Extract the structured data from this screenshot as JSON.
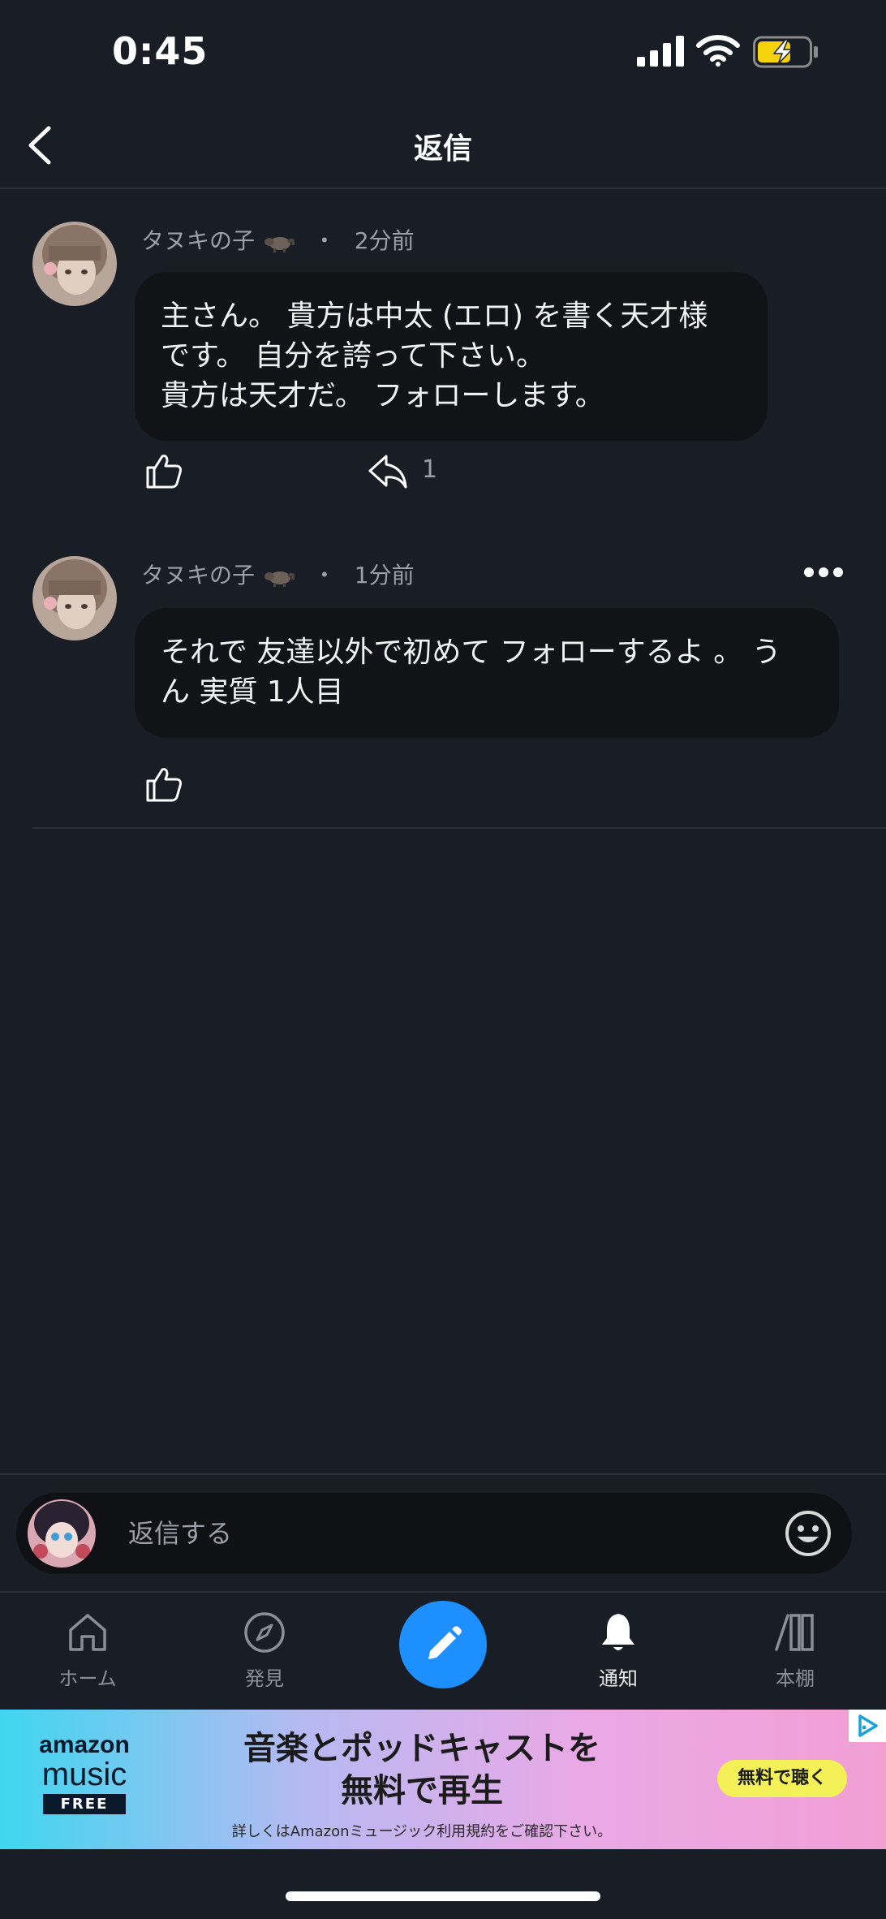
{
  "status_bar": {
    "time": "0:45"
  },
  "header": {
    "title": "返信"
  },
  "comments": [
    {
      "author": "タヌキの子",
      "separator": "・",
      "time_ago": "2分前",
      "body_lines": [
        "主さん。 貴方は中太 (エロ) を書く天才様",
        "です。 自分を誇って下さい。",
        "貴方は天才だ。 フォローします。"
      ],
      "reply_count": "1"
    },
    {
      "author": "タヌキの子",
      "separator": "・",
      "time_ago": "1分前",
      "body_lines": [
        "それで 友達以外で初めて フォローするよ 。 う",
        "ん 実質 1人目"
      ]
    }
  ],
  "reply_box": {
    "placeholder": "返信する"
  },
  "tabbar": {
    "tabs": [
      {
        "label": "ホーム",
        "icon": "home-icon"
      },
      {
        "label": "発見",
        "icon": "compass-icon"
      },
      {
        "label": "通知",
        "icon": "bell-icon",
        "active": true
      },
      {
        "label": "本棚",
        "icon": "bookshelf-icon"
      }
    ],
    "compose_icon": "pencil-icon"
  },
  "ad": {
    "logo_line1": "amazon",
    "logo_line2": "music",
    "logo_badge": "FREE",
    "headline_line1": "音楽とポッドキャストを",
    "headline_line2": "無料で再生",
    "subtext": "詳しくはAmazonミュージック利用規約をご確認下さい。",
    "cta": "無料で聴く"
  },
  "colors": {
    "background": "#191d25",
    "bubble": "#121317",
    "accent": "#1e8fff",
    "muted": "#9aa0a8"
  }
}
